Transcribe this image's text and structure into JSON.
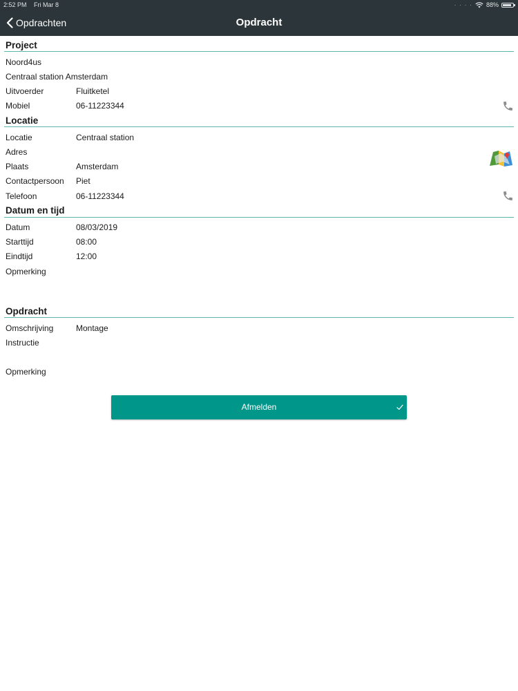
{
  "status_bar": {
    "time": "2:52 PM",
    "date": "Fri Mar 8",
    "battery": "88%",
    "battery_level": 0.88
  },
  "nav": {
    "back_label": "Opdrachten",
    "title": "Opdracht"
  },
  "project": {
    "title": "Project",
    "name": "Noord4us",
    "description": "Centraal station Amsterdam",
    "uitvoerder_label": "Uitvoerder",
    "uitvoerder_value": "Fluitketel",
    "mobiel_label": "Mobiel",
    "mobiel_value": "06-11223344"
  },
  "locatie": {
    "title": "Locatie",
    "locatie_label": "Locatie",
    "locatie_value": "Centraal station",
    "adres_label": "Adres",
    "adres_value": "",
    "plaats_label": "Plaats",
    "plaats_value": "Amsterdam",
    "contact_label": "Contactpersoon",
    "contact_value": "Piet",
    "telefoon_label": "Telefoon",
    "telefoon_value": "06-11223344"
  },
  "datum": {
    "title": "Datum en tijd",
    "datum_label": "Datum",
    "datum_value": "08/03/2019",
    "start_label": "Starttijd",
    "start_value": "08:00",
    "eind_label": "Eindtijd",
    "eind_value": "12:00",
    "opmerking_label": "Opmerking",
    "opmerking_value": ""
  },
  "opdracht": {
    "title": "Opdracht",
    "omschrijving_label": "Omschrijving",
    "omschrijving_value": "Montage",
    "instructie_label": "Instructie",
    "instructie_value": "",
    "opmerking_label": "Opmerking",
    "opmerking_value": ""
  },
  "action": {
    "label": "Afmelden"
  },
  "colors": {
    "bar": "#2c3539",
    "accent": "#00968a",
    "divider": "#5bb5ad",
    "icon_gray": "#8c8c8c"
  },
  "icons": {
    "back": "chevron-left-icon",
    "phone": "phone-icon",
    "map": "map-icon",
    "check": "check-icon",
    "wifi": "wifi-icon",
    "battery": "battery-icon"
  }
}
